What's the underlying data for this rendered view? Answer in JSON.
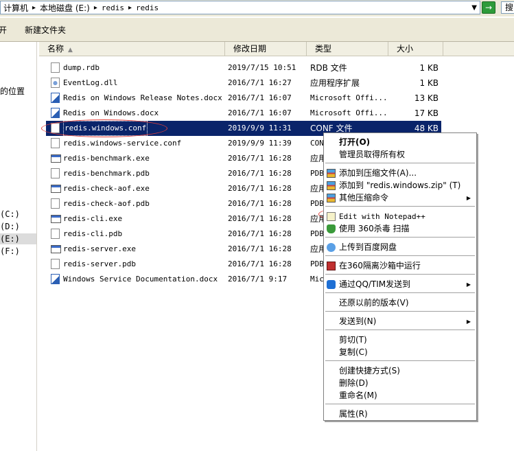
{
  "address": {
    "crumbs": [
      "计算机",
      "本地磁盘 (E:)",
      "redis",
      "redis"
    ],
    "go_label": "→",
    "search_cut": "搜"
  },
  "toolbar": {
    "open": "开",
    "new_folder": "新建文件夹"
  },
  "nav": {
    "places": "的位置",
    "drives": [
      "(C:)",
      "(D:)",
      "(E:)",
      "(F:)"
    ]
  },
  "columns": {
    "name": "名称",
    "date": "修改日期",
    "type": "类型",
    "size": "大小"
  },
  "files": [
    {
      "name": "dump.rdb",
      "date": "2019/7/15 10:51",
      "type": "RDB 文件",
      "size": "1 KB",
      "icon": "file-icon"
    },
    {
      "name": "EventLog.dll",
      "date": "2016/7/1 16:27",
      "type": "应用程序扩展",
      "size": "1 KB",
      "icon": "dll-icon"
    },
    {
      "name": "Redis on Windows Release Notes.docx",
      "date": "2016/7/1 16:07",
      "type": "Microsoft Offi...",
      "size": "13 KB",
      "icon": "word-icon"
    },
    {
      "name": "Redis on Windows.docx",
      "date": "2016/7/1 16:07",
      "type": "Microsoft Offi...",
      "size": "17 KB",
      "icon": "word-icon"
    },
    {
      "name": "redis.windows.conf",
      "date": "2019/9/9 11:31",
      "type": "CONF 文件",
      "size": "48 KB",
      "icon": "file-icon"
    },
    {
      "name": "redis.windows-service.conf",
      "date": "2019/9/9 11:39",
      "type": "CON",
      "size": "",
      "icon": "file-icon"
    },
    {
      "name": "redis-benchmark.exe",
      "date": "2016/7/1 16:28",
      "type": "应用",
      "size": "",
      "icon": "exe-icon"
    },
    {
      "name": "redis-benchmark.pdb",
      "date": "2016/7/1 16:28",
      "type": "PDB",
      "size": "",
      "icon": "file-icon"
    },
    {
      "name": "redis-check-aof.exe",
      "date": "2016/7/1 16:28",
      "type": "应用",
      "size": "",
      "icon": "exe-icon"
    },
    {
      "name": "redis-check-aof.pdb",
      "date": "2016/7/1 16:28",
      "type": "PDB",
      "size": "",
      "icon": "file-icon"
    },
    {
      "name": "redis-cli.exe",
      "date": "2016/7/1 16:28",
      "type": "应用",
      "size": "",
      "icon": "exe-icon"
    },
    {
      "name": "redis-cli.pdb",
      "date": "2016/7/1 16:28",
      "type": "PDB",
      "size": "",
      "icon": "file-icon"
    },
    {
      "name": "redis-server.exe",
      "date": "2016/7/1 16:28",
      "type": "应用",
      "size": "",
      "icon": "exe-icon"
    },
    {
      "name": "redis-server.pdb",
      "date": "2016/7/1 16:28",
      "type": "PDB",
      "size": "",
      "icon": "file-icon"
    },
    {
      "name": "Windows Service Documentation.docx",
      "date": "2016/7/1 9:17",
      "type": "Mic",
      "size": "",
      "icon": "word-icon"
    }
  ],
  "menu": {
    "open": "打开(O)",
    "take_ownership": "管理员取得所有权",
    "add_archive": "添加到压缩文件(A)...",
    "add_zip": "添加到 \"redis.windows.zip\" (T)",
    "other_compress": "其他压缩命令",
    "edit_npp": "Edit with Notepad++",
    "scan_360": "使用 360杀毒 扫描",
    "upload_baidu": "上传到百度网盘",
    "sandbox_360": "在360隔离沙箱中运行",
    "send_qq": "通过QQ/TIM发送到",
    "restore": "还原以前的版本(V)",
    "send_to": "发送到(N)",
    "cut": "剪切(T)",
    "copy": "复制(C)",
    "shortcut": "创建快捷方式(S)",
    "delete": "删除(D)",
    "rename": "重命名(M)",
    "properties": "属性(R)"
  },
  "colors": {
    "selection": "#0a246a",
    "annotation": "#e0403a"
  }
}
